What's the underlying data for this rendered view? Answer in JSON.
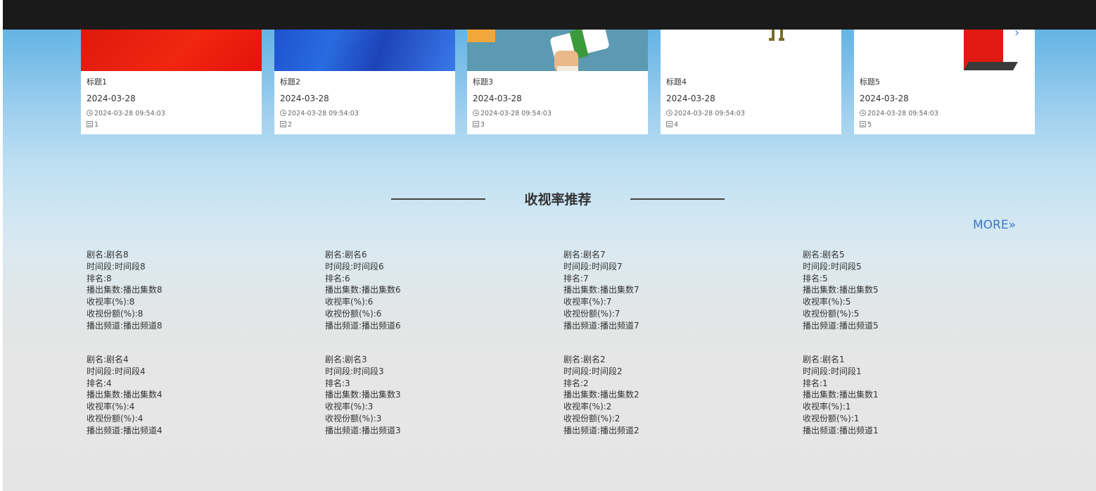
{
  "news": [
    {
      "title": "标题1",
      "date": "2024-03-28",
      "time": "2024-03-28 09:54:03",
      "count": "1"
    },
    {
      "title": "标题2",
      "date": "2024-03-28",
      "time": "2024-03-28 09:54:03",
      "count": "2"
    },
    {
      "title": "标题3",
      "date": "2024-03-28",
      "time": "2024-03-28 09:54:03",
      "count": "3"
    },
    {
      "title": "标题4",
      "date": "2024-03-28",
      "time": "2024-03-28 09:54:03",
      "count": "4"
    },
    {
      "title": "标题5",
      "date": "2024-03-28",
      "time": "2024-03-28 09:54:03",
      "count": "5"
    }
  ],
  "section": {
    "title": "收视率推荐",
    "more": "MORE»"
  },
  "ratings": [
    {
      "name": "剧名:剧名8",
      "slot": "时间段:时间段8",
      "rank": "排名:8",
      "episodes": "播出集数:播出集数8",
      "rate": "收视率(%):8",
      "share": "收视份额(%):8",
      "channel": "播出频道:播出频道8"
    },
    {
      "name": "剧名:剧名6",
      "slot": "时间段:时间段6",
      "rank": "排名:6",
      "episodes": "播出集数:播出集数6",
      "rate": "收视率(%):6",
      "share": "收视份额(%):6",
      "channel": "播出频道:播出频道6"
    },
    {
      "name": "剧名:剧名7",
      "slot": "时间段:时间段7",
      "rank": "排名:7",
      "episodes": "播出集数:播出集数7",
      "rate": "收视率(%):7",
      "share": "收视份额(%):7",
      "channel": "播出频道:播出频道7"
    },
    {
      "name": "剧名:剧名5",
      "slot": "时间段:时间段5",
      "rank": "排名:5",
      "episodes": "播出集数:播出集数5",
      "rate": "收视率(%):5",
      "share": "收视份额(%):5",
      "channel": "播出频道:播出频道5"
    },
    {
      "name": "剧名:剧名4",
      "slot": "时间段:时间段4",
      "rank": "排名:4",
      "episodes": "播出集数:播出集数4",
      "rate": "收视率(%):4",
      "share": "收视份额(%):4",
      "channel": "播出频道:播出频道4"
    },
    {
      "name": "剧名:剧名3",
      "slot": "时间段:时间段3",
      "rank": "排名:3",
      "episodes": "播出集数:播出集数3",
      "rate": "收视率(%):3",
      "share": "收视份额(%):3",
      "channel": "播出频道:播出频道3"
    },
    {
      "name": "剧名:剧名2",
      "slot": "时间段:时间段2",
      "rank": "排名:2",
      "episodes": "播出集数:播出集数2",
      "rate": "收视率(%):2",
      "share": "收视份额(%):2",
      "channel": "播出频道:播出频道2"
    },
    {
      "name": "剧名:剧名1",
      "slot": "时间段:时间段1",
      "rank": "排名:1",
      "episodes": "播出集数:播出集数1",
      "rate": "收视率(%):1",
      "share": "收视份额(%):1",
      "channel": "播出频道:播出频道1"
    }
  ]
}
